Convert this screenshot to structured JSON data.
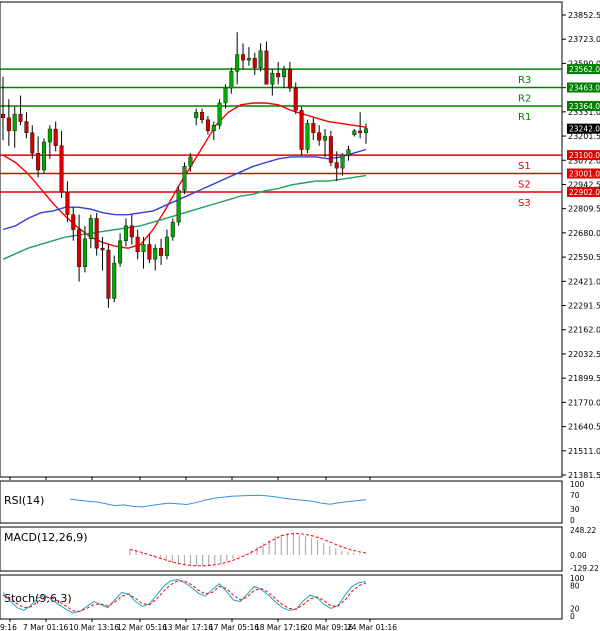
{
  "colors": {
    "background": "#ffffff",
    "frame": "#000000",
    "grid": "#c8c8c8",
    "bull": "#00a800",
    "bear": "#d40000",
    "wick": "#000000",
    "resistance": "#008000",
    "support": "#e00000",
    "ma_fast": "#ff0000",
    "ma_mid": "#3040d8",
    "ma_slow": "#20a060",
    "rsi": "#3a8ee6",
    "macd_hist": "#b0b0b0",
    "macd_signal": "#ff0000",
    "stoch_main": "#1ca8c0",
    "stoch_signal": "#ff0000",
    "tag_red": "#e00000",
    "tag_green": "#008000",
    "tag_black": "#000000"
  },
  "chart_data": [
    {
      "type": "candlestick",
      "ylim": [
        21381.5,
        23852.5
      ],
      "y_ticks": [
        "23852.5",
        "23723.0",
        "23590.0",
        "23460.5",
        "23331.0",
        "23201.5",
        "23072.0",
        "22942.5",
        "22809.5",
        "22680.0",
        "22550.5",
        "22421.0",
        "22291.5",
        "22162.0",
        "22032.5",
        "21899.5",
        "21770.0",
        "21640.5",
        "21511.0",
        "21381.5"
      ],
      "x_ticks": [
        "9:16",
        "7 Mar 01:16",
        "10 Mar 13:16",
        "12 Mar 05:16",
        "13 Mar 17:16",
        "17 Mar 05:16",
        "18 Mar 17:16",
        "20 Mar 09:16",
        "24 Mar 01:16"
      ],
      "grid": true,
      "levels": [
        {
          "name": "R3",
          "value": 23562.0,
          "tag": "23562.0",
          "kind": "resistance"
        },
        {
          "name": "R2",
          "value": 23463.0,
          "tag": "23463.0",
          "kind": "resistance"
        },
        {
          "name": "R1",
          "value": 23364.0,
          "tag": "23364.0",
          "kind": "resistance"
        },
        {
          "name": "S1",
          "value": 23100.0,
          "tag": "23100.0",
          "kind": "support"
        },
        {
          "name": "S2",
          "value": 23001.0,
          "tag": "23001.0",
          "kind": "support"
        },
        {
          "name": "S3",
          "value": 22902.0,
          "tag": "22902.0",
          "kind": "support"
        }
      ],
      "current_price": {
        "value": 23242.0,
        "tag": "23242.0"
      },
      "candles": [
        [
          23320,
          23520,
          23180,
          23300
        ],
        [
          23300,
          23400,
          23150,
          23230
        ],
        [
          23230,
          23360,
          23140,
          23320
        ],
        [
          23320,
          23420,
          23260,
          23280
        ],
        [
          23280,
          23330,
          23190,
          23220
        ],
        [
          23220,
          23260,
          23080,
          23110
        ],
        [
          23110,
          23200,
          22980,
          23020
        ],
        [
          23020,
          23190,
          23000,
          23170
        ],
        [
          23170,
          23260,
          23080,
          23240
        ],
        [
          23240,
          23280,
          23120,
          23150
        ],
        [
          23150,
          23230,
          22870,
          22900
        ],
        [
          22900,
          22960,
          22740,
          22780
        ],
        [
          22780,
          22820,
          22640,
          22700
        ],
        [
          22700,
          22780,
          22420,
          22500
        ],
        [
          22500,
          22720,
          22470,
          22650
        ],
        [
          22650,
          22780,
          22600,
          22760
        ],
        [
          22760,
          22790,
          22560,
          22600
        ],
        [
          22600,
          22660,
          22480,
          22590
        ],
        [
          22590,
          22620,
          22280,
          22330
        ],
        [
          22330,
          22560,
          22310,
          22520
        ],
        [
          22520,
          22680,
          22500,
          22640
        ],
        [
          22640,
          22760,
          22610,
          22720
        ],
        [
          22720,
          22780,
          22620,
          22660
        ],
        [
          22660,
          22700,
          22540,
          22580
        ],
        [
          22580,
          22660,
          22490,
          22620
        ],
        [
          22620,
          22680,
          22520,
          22540
        ],
        [
          22540,
          22620,
          22480,
          22600
        ],
        [
          22600,
          22650,
          22510,
          22560
        ],
        [
          22560,
          22700,
          22540,
          22660
        ],
        [
          22660,
          22760,
          22640,
          22740
        ],
        [
          22740,
          22930,
          22720,
          22910
        ],
        [
          22910,
          23060,
          22890,
          23040
        ],
        [
          23040,
          23110,
          23010,
          23090
        ],
        [
          23300,
          23350,
          23260,
          23330
        ],
        [
          23330,
          23350,
          23270,
          23290
        ],
        [
          23290,
          23310,
          23210,
          23230
        ],
        [
          23230,
          23280,
          23180,
          23260
        ],
        [
          23260,
          23400,
          23240,
          23380
        ],
        [
          23380,
          23480,
          23350,
          23460
        ],
        [
          23460,
          23570,
          23430,
          23550
        ],
        [
          23550,
          23760,
          23480,
          23640
        ],
        [
          23640,
          23700,
          23560,
          23610
        ],
        [
          23610,
          23680,
          23580,
          23620
        ],
        [
          23620,
          23650,
          23530,
          23570
        ],
        [
          23570,
          23700,
          23550,
          23660
        ],
        [
          23660,
          23710,
          23520,
          23480
        ],
        [
          23480,
          23560,
          23420,
          23540
        ],
        [
          23540,
          23600,
          23480,
          23520
        ],
        [
          23520,
          23580,
          23460,
          23560
        ],
        [
          23560,
          23600,
          23440,
          23460
        ],
        [
          23460,
          23490,
          23320,
          23340
        ],
        [
          23340,
          23360,
          23100,
          23130
        ],
        [
          23130,
          23290,
          23110,
          23270
        ],
        [
          23270,
          23300,
          23180,
          23220
        ],
        [
          23220,
          23260,
          23150,
          23180
        ],
        [
          23180,
          23240,
          23090,
          23200
        ],
        [
          23200,
          23230,
          23040,
          23060
        ],
        [
          23060,
          23120,
          22960,
          23030
        ],
        [
          23030,
          23110,
          22990,
          23100
        ],
        [
          23100,
          23150,
          23070,
          23130
        ],
        [
          23210,
          23240,
          23200,
          23230
        ],
        [
          23230,
          23330,
          23190,
          23220
        ],
        [
          23220,
          23270,
          23160,
          23242
        ]
      ],
      "moving_averages": [
        {
          "name": "MA fast",
          "values": [
            23100,
            23060,
            23000,
            22920,
            22840,
            22770,
            22710,
            22660,
            22630,
            22610,
            22600,
            22620,
            22700,
            22810,
            22930,
            23040,
            23150,
            23260,
            23330,
            23370,
            23380,
            23380,
            23370,
            23340,
            23320,
            23300,
            23280,
            23270,
            23260,
            23250
          ]
        },
        {
          "name": "MA mid",
          "values": [
            22700,
            22720,
            22760,
            22790,
            22800,
            22820,
            22820,
            22810,
            22790,
            22780,
            22780,
            22790,
            22800,
            22830,
            22860,
            22890,
            22920,
            22950,
            22980,
            23010,
            23040,
            23060,
            23080,
            23090,
            23090,
            23090,
            23080,
            23090,
            23110,
            23130
          ]
        },
        {
          "name": "MA slow",
          "values": [
            22540,
            22570,
            22600,
            22620,
            22640,
            22660,
            22670,
            22680,
            22690,
            22700,
            22710,
            22720,
            22740,
            22760,
            22780,
            22800,
            22820,
            22840,
            22860,
            22880,
            22890,
            22910,
            22920,
            22940,
            22950,
            22960,
            22960,
            22970,
            22980,
            22990
          ]
        }
      ]
    },
    {
      "type": "line",
      "title": "RSI(14)",
      "y_ticks": [
        "100",
        "70",
        "30",
        "0"
      ],
      "ylim": [
        0,
        100
      ],
      "values": [
        58,
        55,
        52,
        50,
        45,
        40,
        42,
        38,
        36,
        40,
        44,
        47,
        45,
        43,
        48,
        55,
        60,
        63,
        66,
        67,
        68,
        69,
        67,
        64,
        60,
        57,
        55,
        52,
        47,
        44,
        48,
        51,
        54,
        56
      ]
    },
    {
      "type": "bar",
      "title": "MACD(12,26,9)",
      "y_ticks": [
        "248.22",
        "0.00",
        "-129.22"
      ],
      "ylim": [
        -129.22,
        248.22
      ],
      "histogram": [
        60,
        40,
        20,
        0,
        -20,
        -40,
        -60,
        -80,
        -95,
        -105,
        -110,
        -112,
        -110,
        -105,
        -95,
        -80,
        -60,
        -35,
        -10,
        15,
        45,
        80,
        115,
        150,
        185,
        205,
        215,
        215,
        205,
        190,
        170,
        145,
        115,
        90,
        65,
        45,
        30,
        20,
        10,
        5
      ],
      "signal": [
        55,
        42,
        25,
        6,
        -14,
        -33,
        -52,
        -70,
        -85,
        -96,
        -103,
        -107,
        -107,
        -104,
        -98,
        -87,
        -72,
        -53,
        -30,
        -5,
        24,
        57,
        92,
        127,
        162,
        190,
        205,
        212,
        212,
        205,
        193,
        175,
        155,
        130,
        105,
        80,
        60,
        45,
        30,
        20
      ]
    },
    {
      "type": "line",
      "title": "Stoch(9,6,3)",
      "y_ticks": [
        "100",
        "80",
        "20",
        "0"
      ],
      "ylim": [
        0,
        100
      ],
      "series": [
        {
          "values": [
            62,
            40,
            22,
            15,
            28,
            48,
            55,
            42,
            30,
            18,
            8,
            12,
            25,
            38,
            30,
            22,
            42,
            62,
            58,
            38,
            25,
            32,
            55,
            78,
            92,
            96,
            88,
            75,
            60,
            52,
            70,
            85,
            65,
            42,
            38,
            58,
            78,
            70,
            55,
            38,
            22,
            15,
            18,
            40,
            55,
            48,
            30,
            20,
            28,
            55,
            78,
            88,
            90
          ]
        },
        {
          "values": [
            55,
            48,
            32,
            22,
            24,
            38,
            50,
            48,
            38,
            26,
            14,
            12,
            20,
            30,
            32,
            26,
            36,
            52,
            58,
            46,
            32,
            30,
            45,
            65,
            82,
            92,
            92,
            82,
            68,
            58,
            62,
            78,
            72,
            55,
            42,
            50,
            68,
            72,
            62,
            46,
            30,
            20,
            18,
            30,
            45,
            50,
            40,
            26,
            26,
            42,
            65,
            80,
            86
          ]
        }
      ]
    }
  ]
}
